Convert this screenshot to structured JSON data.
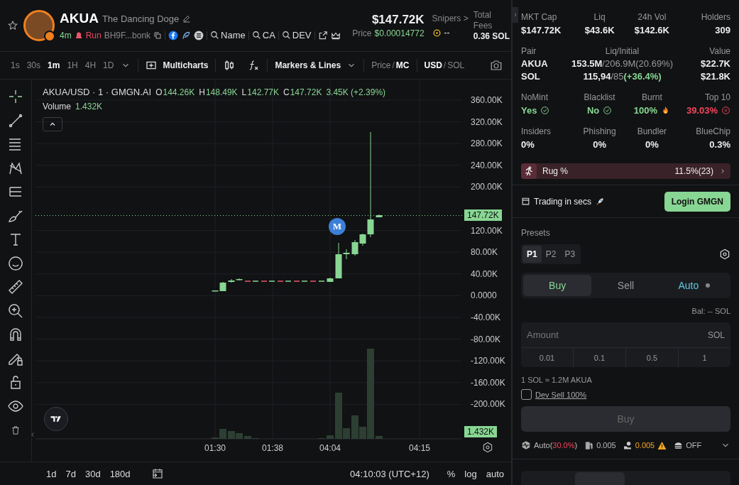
{
  "header": {
    "token_symbol": "AKUA",
    "token_name": "The Dancing Doge",
    "age": "4m",
    "status": "Run",
    "address": "BH9F...bonk",
    "search_links": [
      "Name",
      "CA",
      "DEV"
    ],
    "market_cap": "$147.72K",
    "price_label": "Price",
    "price": "$0.00014772",
    "snipers_label": "Snipers >",
    "snipers_value": "--",
    "fees_label": "Total Fees",
    "fees_value": "0.36 SOL"
  },
  "toolbar": {
    "intervals": [
      {
        "label": "1s",
        "selected": false
      },
      {
        "label": "30s",
        "selected": false
      },
      {
        "label": "1m",
        "selected": true
      },
      {
        "label": "1H",
        "selected": false
      },
      {
        "label": "4H",
        "selected": false
      },
      {
        "label": "1D",
        "selected": false
      }
    ],
    "multicharts": "Multicharts",
    "markers": "Markers & Lines",
    "price_mode": [
      {
        "label": "Price",
        "selected": false
      },
      {
        "label": "MC",
        "selected": true
      }
    ],
    "currency": [
      {
        "label": "USD",
        "selected": true
      },
      {
        "label": "SOL",
        "selected": false
      }
    ],
    "toggle_separator": "/"
  },
  "chart": {
    "symbol": "AKUA/USD · 1 · GMGN.AI",
    "ohlc": [
      {
        "key": "O",
        "value": "144.26K"
      },
      {
        "key": "H",
        "value": "148.49K"
      },
      {
        "key": "L",
        "value": "142.77K"
      },
      {
        "key": "C",
        "value": "147.72K"
      }
    ],
    "change": "3.45K (+2.39%)",
    "volume_label": "Volume",
    "volume_value": "1.432K",
    "marker": "M",
    "y_labels": [
      "360.00K",
      "320.00K",
      "280.00K",
      "240.00K",
      "200.00K",
      "120.00K",
      "80.00K",
      "40.00K",
      "0.0000",
      "-40.00K",
      "-80.00K",
      "-120.00K",
      "-160.00K",
      "-200.00K"
    ],
    "x_labels": [
      "01:30",
      "01:38",
      "04:04",
      "04:15"
    ],
    "last_price_tag": "147.72K",
    "volume_tag": "1.432K"
  },
  "bottom_bar": {
    "ranges": [
      "1d",
      "7d",
      "30d",
      "180d"
    ],
    "clock": "04:10:03 (UTC+12)",
    "options": [
      "%",
      "log",
      "auto"
    ]
  },
  "stats": [
    {
      "label": "MKT Cap",
      "value": "$147.72K"
    },
    {
      "label": "Liq",
      "value": "$43.6K"
    },
    {
      "label": "24h Vol",
      "value": "$142.6K"
    },
    {
      "label": "Holders",
      "value": "309"
    }
  ],
  "pair": {
    "headers": [
      "Pair",
      "Liq/Initial",
      "Value"
    ],
    "rows": [
      {
        "token": "AKUA",
        "liq": "153.5M",
        "initial": "/206.9M(20.69%)",
        "value": "$22.7K"
      },
      {
        "token": "SOL",
        "liq": "115,94",
        "initial": "/85",
        "change": "(+36.4%)",
        "value": "$21.8K"
      }
    ]
  },
  "checks": [
    {
      "label": "NoMint",
      "value": "Yes",
      "kind": "good"
    },
    {
      "label": "Blacklist",
      "value": "No",
      "kind": "good"
    },
    {
      "label": "Burnt",
      "value": "100%",
      "kind": "burn"
    },
    {
      "label": "Top 10",
      "value": "39.03%",
      "kind": "bad"
    }
  ],
  "holder_stats": [
    {
      "label": "Insiders",
      "value": "0%"
    },
    {
      "label": "Phishing",
      "value": "0%"
    },
    {
      "label": "Bundler",
      "value": "0%"
    },
    {
      "label": "BlueChip",
      "value": "0.3%"
    }
  ],
  "rug": {
    "label": "Rug %",
    "value": "11.5%(23)"
  },
  "trade": {
    "promo": "Trading in secs",
    "login": "Login GMGN",
    "presets_label": "Presets",
    "presets": [
      {
        "label": "P1",
        "selected": true
      },
      {
        "label": "P2",
        "selected": false
      },
      {
        "label": "P3",
        "selected": false
      }
    ],
    "modes": [
      {
        "label": "Buy",
        "selected": true,
        "kind": "buy"
      },
      {
        "label": "Sell",
        "selected": false,
        "kind": "sell"
      },
      {
        "label": "Auto",
        "selected": false,
        "kind": "auto"
      }
    ],
    "balance": "Bal: -- SOL",
    "amount_placeholder": "Amount",
    "amount_unit": "SOL",
    "quick_amounts": [
      "0.01",
      "0.1",
      "0.5",
      "1"
    ],
    "rate": "1 SOL ≈ 1.2M AKUA",
    "dev_sell": {
      "label": "Dev Sell 100%",
      "checked": false
    },
    "submit": {
      "label": "Buy",
      "disabled": true
    },
    "settings": {
      "slippage_prefix": "Auto(",
      "slippage": "30.0%",
      "slippage_suffix": ")",
      "priority_fee": "0.005",
      "tip": "0.005",
      "anti_mev": "OFF"
    }
  }
}
